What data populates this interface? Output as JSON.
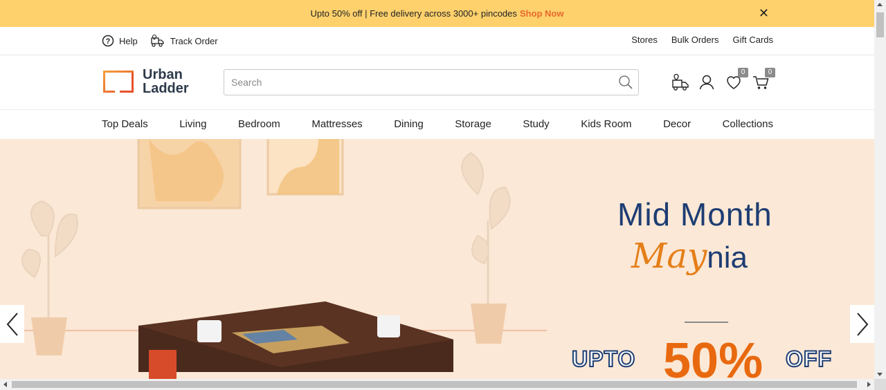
{
  "promo": {
    "text": "Upto 50% off | Free delivery across 3000+ pincodes",
    "link": "Shop Now",
    "close": "✕"
  },
  "util": {
    "help": "Help",
    "track": "Track Order",
    "stores": "Stores",
    "bulk": "Bulk Orders",
    "gift": "Gift Cards"
  },
  "header": {
    "logo_line1": "Urban",
    "logo_line2": "Ladder",
    "search_placeholder": "Search",
    "wishlist_count": "0",
    "cart_count": "0"
  },
  "nav": {
    "items": [
      "Top Deals",
      "Living",
      "Bedroom",
      "Mattresses",
      "Dining",
      "Storage",
      "Study",
      "Kids Room",
      "Decor",
      "Collections"
    ]
  },
  "hero": {
    "line1": "Mid Month",
    "line2_script": "May",
    "line2_rest": "nia",
    "upto": "UPTO",
    "percent": "50%",
    "off": "OFF"
  },
  "colors": {
    "promo_bg": "#fed16d",
    "accent": "#e8682a",
    "hero_bg": "#fbe8d6",
    "navy": "#1d3d73"
  }
}
